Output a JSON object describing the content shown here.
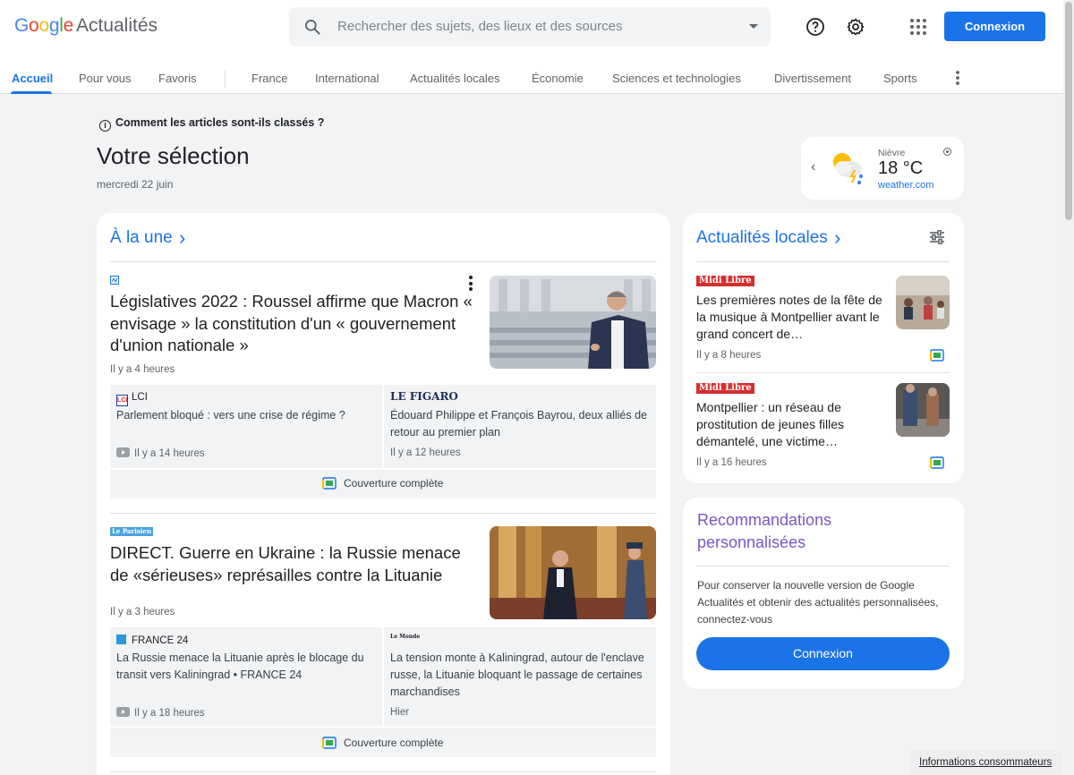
{
  "header": {
    "logo_google": "Google",
    "logo_suffix": "Actualités",
    "search_placeholder": "Rechercher des sujets, des lieux et des sources",
    "connexion_label": "Connexion"
  },
  "nav": {
    "items": [
      "Accueil",
      "Pour vous",
      "Favoris",
      "France",
      "International",
      "Actualités locales",
      "Économie",
      "Sciences et technologies",
      "Divertissement",
      "Sports"
    ],
    "active": "Accueil"
  },
  "main": {
    "ranking_info": "Comment les articles sont-ils classés ?",
    "title": "Votre sélection",
    "date": "mercredi 22 juin"
  },
  "weather": {
    "city": "Nièvre",
    "temp": "18 °C",
    "source": "weather.com"
  },
  "top_stories": {
    "title": "À la une",
    "stories": [
      {
        "title": "Législatives 2022 : Roussel affirme que Macron « envisage » la constitution d'un « gouvernement d'union nationale »",
        "time": "Il y a 4 heures",
        "related": [
          {
            "source": "LCI",
            "text": "Parlement bloqué : vers une crise de régime ?",
            "time": "Il y a 14 heures"
          },
          {
            "source": "LE FIGARO",
            "text": "Édouard Philippe et François Bayrou, deux alliés de retour au premier plan",
            "time": "Il y a 12 heures"
          }
        ],
        "coverage": "Couverture complète"
      },
      {
        "source": "Le Parisien",
        "title": "DIRECT. Guerre en Ukraine : la Russie menace de «sérieuses» représailles contre la Lituanie",
        "time": "Il y a 3 heures",
        "related": [
          {
            "source": "FRANCE 24",
            "text": "La Russie menace la Lituanie après le blocage du transit vers Kaliningrad • FRANCE 24",
            "time": "Il y a 18 heures"
          },
          {
            "source": "Le Monde",
            "text": "La tension monte à Kaliningrad, autour de l'enclave russe, la Lituanie bloquant le passage de certaines marchandises",
            "time": "Hier"
          }
        ],
        "coverage": "Couverture complète"
      }
    ]
  },
  "local_news": {
    "title": "Actualités locales",
    "items": [
      {
        "source": "Midi Libre",
        "title": "Les premières notes de la fête de la musique à Montpellier avant le grand concert de…",
        "time": "Il y a 8 heures"
      },
      {
        "source": "Midi Libre",
        "title": "Montpellier : un réseau de prostitution de jeunes filles démantelé, une victime…",
        "time": "Il y a 16 heures"
      }
    ]
  },
  "recommendations": {
    "title": "Recommandations personnalisées",
    "text": "Pour conserver la nouvelle version de Google Actualités et obtenir des actualités personnalisées, connectez-vous",
    "button": "Connexion"
  },
  "footer": {
    "consumer_info": "Informations consommateurs"
  },
  "colors": {
    "accent": "#1a73e8",
    "reco_title": "#7b55c7",
    "midi_libre": "#d32f2f"
  }
}
